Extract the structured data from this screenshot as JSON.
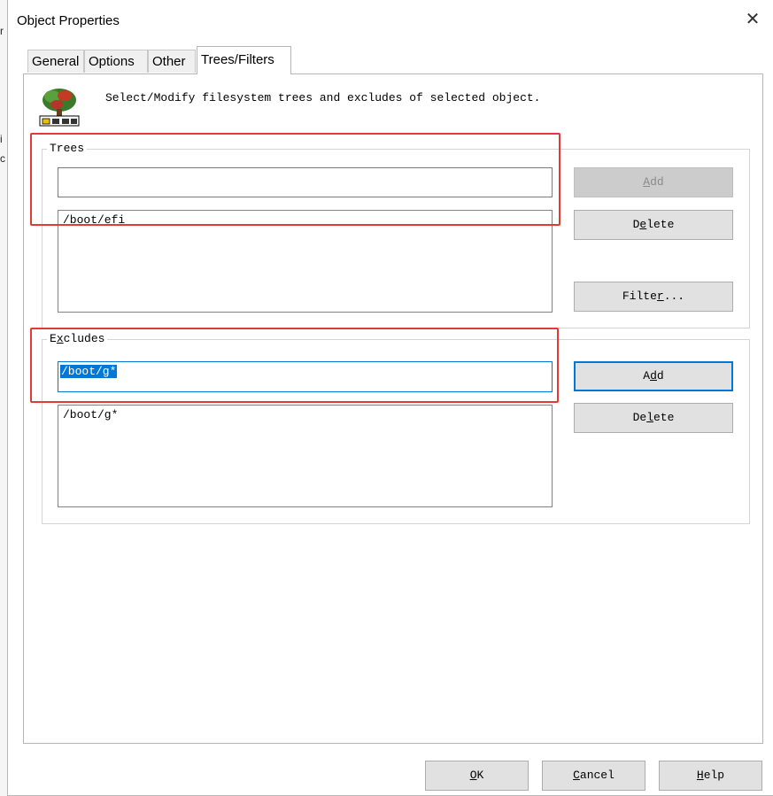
{
  "window": {
    "title": "Object Properties",
    "close_glyph": "✕"
  },
  "tabs": [
    {
      "label": "General"
    },
    {
      "label": "Options"
    },
    {
      "label": "Other"
    },
    {
      "label": "Trees/Filters"
    }
  ],
  "active_tab": "Trees/Filters",
  "description": "Select/Modify filesystem trees and excludes of selected object.",
  "icon": "tree-folder-icon",
  "trees": {
    "legend": "Trees",
    "input_value": "",
    "list": [
      "/boot/efi"
    ],
    "add_label": "Add",
    "delete_label": "Delete",
    "filter_label": "Filter..."
  },
  "excludes": {
    "legend": "Excludes",
    "input_value": "/boot/g*",
    "list": [
      "/boot/g*"
    ],
    "add_label": "Add",
    "delete_label": "Delete"
  },
  "footer": {
    "ok_label": "OK",
    "cancel_label": "Cancel",
    "help_label": "Help"
  },
  "colors": {
    "highlight": "#e53935",
    "selection": "#0078d7"
  }
}
